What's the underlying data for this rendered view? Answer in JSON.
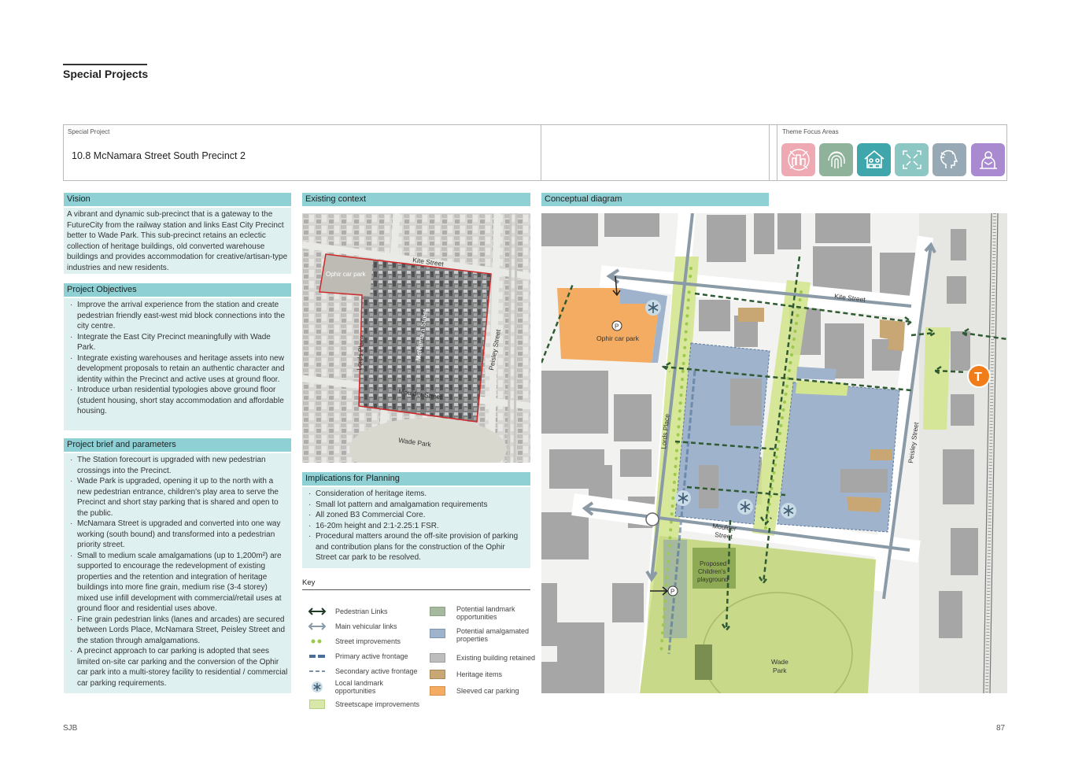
{
  "page": {
    "title": "Special Projects",
    "footer_left": "SJB",
    "page_number": "87"
  },
  "header": {
    "special_project_label": "Special Project",
    "project_title": "10.8  McNamara Street South Precinct 2",
    "theme_focus_label": "Theme Focus Areas",
    "theme_icons": [
      {
        "icon": "city-network-icon",
        "color": "#eea9b3"
      },
      {
        "icon": "fingerprint-icon",
        "color": "#8fb39a"
      },
      {
        "icon": "housing-community-icon",
        "color": "#3fa6ab"
      },
      {
        "icon": "expand-frame-icon",
        "color": "#8cc7c4"
      },
      {
        "icon": "health-head-icon",
        "color": "#97a9b4"
      },
      {
        "icon": "education-person-icon",
        "color": "#a98ad0"
      }
    ]
  },
  "vision": {
    "heading": "Vision",
    "text": "A vibrant and dynamic sub-precinct that is a gateway to the FutureCity from the railway station and links East City Precinct better to Wade Park. This sub-precinct retains an eclectic collection of heritage buildings, old converted warehouse buildings and provides accommodation for creative/artisan-type industries and new residents."
  },
  "objectives": {
    "heading": "Project Objectives",
    "items": [
      "Improve the arrival experience from the station and create pedestrian friendly east-west mid block connections into the city centre.",
      "Integrate the East City Precinct meaningfully with Wade Park.",
      "Integrate existing warehouses and heritage assets into new development proposals to retain an authentic character and identity within the Precinct and active uses at ground floor.",
      "Introduce urban residential typologies above ground floor (student housing, short stay accommodation and affordable housing."
    ]
  },
  "brief": {
    "heading": "Project brief and parameters",
    "items": [
      "The Station forecourt is upgraded with new pedestrian crossings into the Precinct.",
      "Wade Park is upgraded, opening it up to the north with a new pedestrian entrance, children's play area to serve the Precinct and short stay parking that is shared and open to the public.",
      "McNamara Street is upgraded and converted into one way working (south bound) and transformed into a pedestrian priority street.",
      "Small to medium scale amalgamations (up to 1,200m²) are supported to encourage the redevelopment of existing properties and the retention and integration of heritage buildings into more fine grain, medium rise (3-4 storey) mixed use infill development with commercial/retail uses at ground floor and residential uses above.",
      "Fine grain pedestrian links (lanes and arcades) are secured between Lords Place, McNamara Street, Peisley Street and the station through amalgamations.",
      "A precinct approach to car parking is adopted that sees limited on-site car parking and the conversion of the Ophir car park into a multi-storey facility to residential / commercial car parking requirements."
    ]
  },
  "existing_context": {
    "heading": "Existing context",
    "labels": {
      "kite": "Kite Street",
      "ophir": "Ophir car park",
      "lords": "Lords Place",
      "mcnamara": "McNamara Street",
      "peisley": "Peisley Street",
      "moulder": "Moulder Street",
      "wade": "Wade Park"
    }
  },
  "implications": {
    "heading": "Implications for Planning",
    "items": [
      "Consideration of heritage items.",
      "Small lot pattern and amalgamation requirements",
      "All zoned B3 Commercial Core.",
      "16-20m height and 2:1-2.25:1 FSR.",
      "Procedural matters around the off-site provision of parking and contribution plans for the construction of the Ophir Street car park to be resolved."
    ]
  },
  "concept": {
    "heading": "Conceptual diagram",
    "labels": {
      "kite": "Kite Street",
      "ophir": "Ophir car park",
      "lords": "Lords Place",
      "moulder_1": "Moulder",
      "moulder_2": "Street",
      "peisley": "Peisley Street",
      "playground_1": "Proposed",
      "playground_2": "Children's",
      "playground_3": "playground",
      "wade_1": "Wade",
      "wade_2": "Park",
      "parking": "P",
      "station": "T"
    }
  },
  "key": {
    "title": "Key",
    "left": [
      {
        "label": "Pedestrian Links",
        "icon": "double-arrow-dark-icon"
      },
      {
        "label": "Main vehicular links",
        "icon": "double-arrow-grey-icon"
      },
      {
        "label": "Street improvements",
        "icon": "dots-green-icon"
      },
      {
        "label": "Primary active frontage",
        "icon": "dash-thick-blue-icon"
      },
      {
        "label": "Secondary active frontage",
        "icon": "dash-thin-blue-icon"
      },
      {
        "label": "Local landmark opportunities",
        "icon": "asterisk-icon"
      },
      {
        "label": "Streetscape improvements",
        "icon": "swatch-lightgreen-icon"
      }
    ],
    "right": [
      {
        "label_1": "Potential landmark",
        "label_2": "opportunities",
        "color": "#a5b99e"
      },
      {
        "label_1": "Potential amalgamated",
        "label_2": "properties",
        "color": "#9fb3cc"
      },
      {
        "label_1": "Existing building retained",
        "label_2": "",
        "color": "#bdbdbd"
      },
      {
        "label_1": "Heritage items",
        "label_2": "",
        "color": "#c9a774"
      },
      {
        "label_1": "Sleeved car parking",
        "label_2": "",
        "color": "#f4ac62"
      }
    ]
  }
}
